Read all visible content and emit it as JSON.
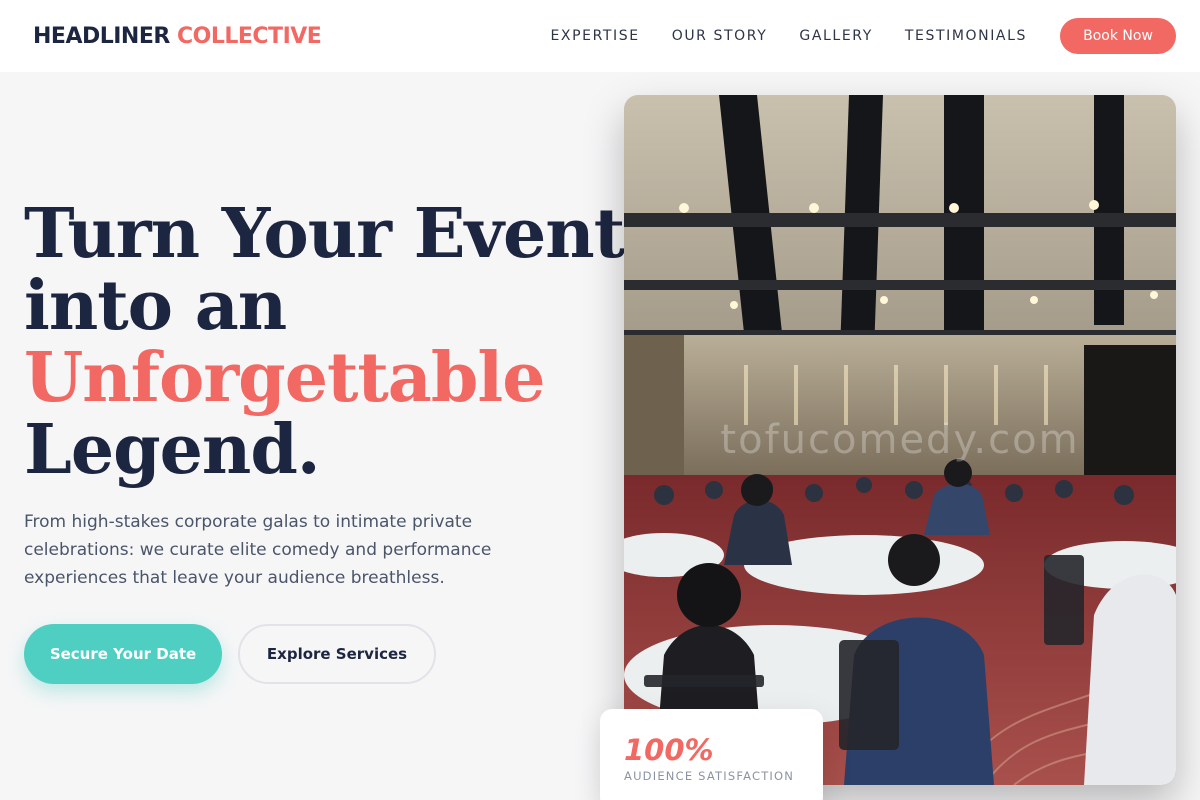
{
  "brand": {
    "name_main": "HEADLINER",
    "name_accent": "COLLECTIVE"
  },
  "nav": {
    "items": [
      "EXPERTISE",
      "OUR STORY",
      "GALLERY",
      "TESTIMONIALS"
    ],
    "cta_label": "Book Now"
  },
  "hero": {
    "headline_lines": [
      "Turn Your Event",
      "into an",
      "Unforgettable",
      "Legend."
    ],
    "subtext": "From high-stakes corporate galas to intimate private celebrations: we curate elite comedy and performance experiences that leave your audience breathless.",
    "primary_cta": "Secure Your Date",
    "secondary_cta": "Explore Services"
  },
  "photo": {
    "watermark": "tofucomedy.com"
  },
  "stat": {
    "value": "100%",
    "label": "AUDIENCE SATISFACTION"
  },
  "colors": {
    "accent": "#f26863",
    "teal": "#4fcfc2",
    "navy": "#1d2640"
  }
}
